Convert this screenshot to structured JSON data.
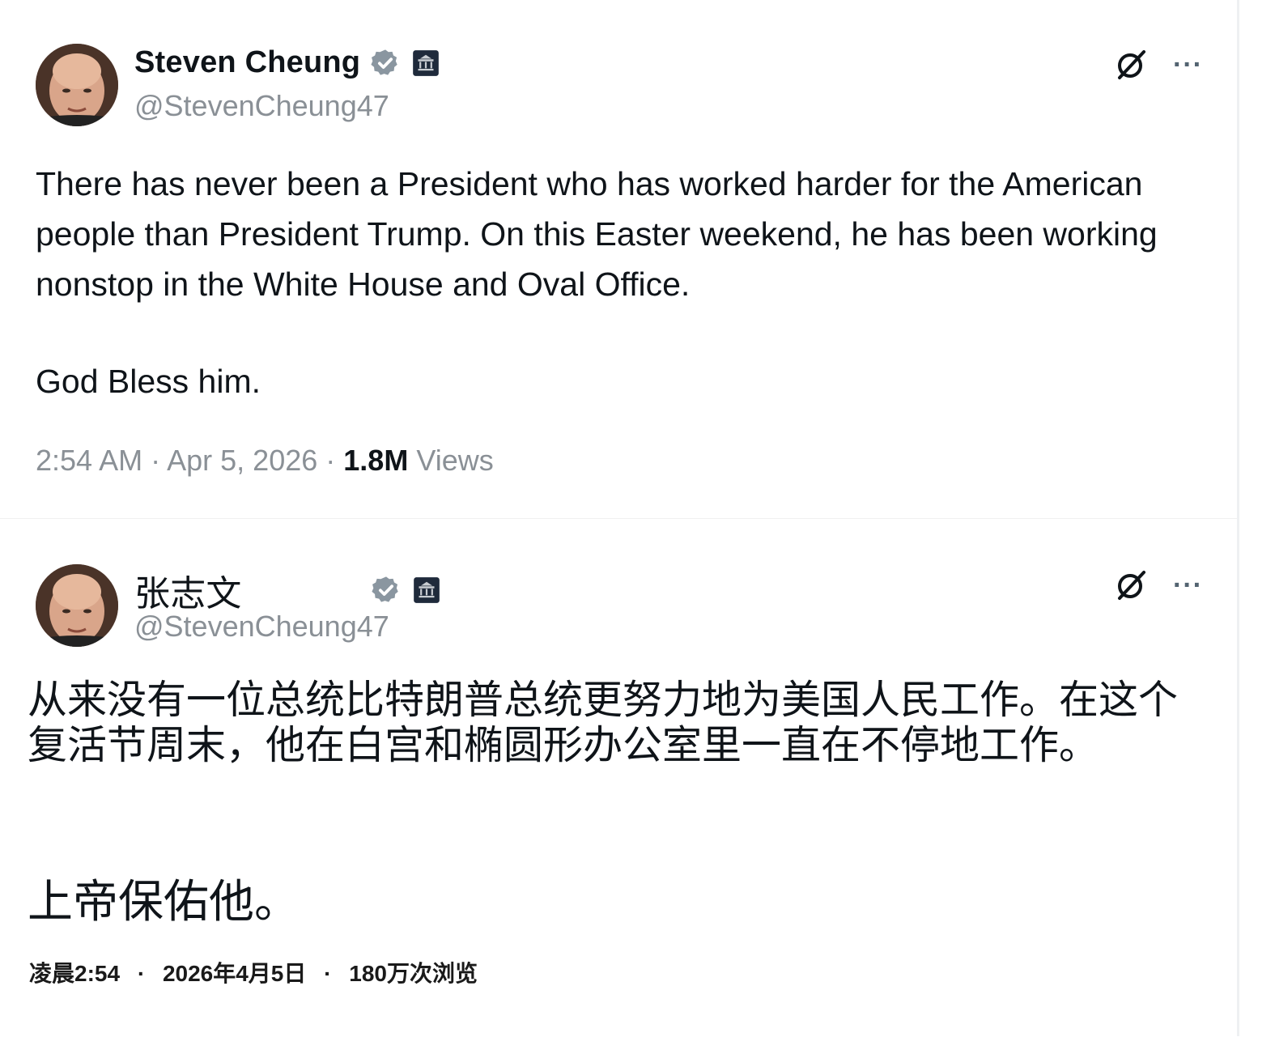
{
  "colors": {
    "text_primary": "#0f1419",
    "text_secondary": "#8a9096",
    "verified_badge": "#8a96a0",
    "gov_badge": "#1f2a3b"
  },
  "tweets": [
    {
      "author": {
        "display_name": "Steven Cheung",
        "handle": "@StevenCheung47",
        "verified_icon": "verified-badge-icon",
        "affiliation_icon": "government-badge-icon"
      },
      "actions": {
        "grok_icon": "grok-icon",
        "more_label": "···"
      },
      "body": {
        "main": "There has never been a President who has worked harder for the American people than President Trump. On this Easter weekend, he has been working nonstop in the White House and Oval Office.",
        "closing": "God Bless him."
      },
      "meta": {
        "time": "2:54 AM",
        "separator": "·",
        "date": "Apr 5, 2026",
        "views_count": "1.8M",
        "views_label": "Views"
      }
    },
    {
      "author": {
        "display_name": "张志文",
        "handle": "@StevenCheung47",
        "verified_icon": "verified-badge-icon",
        "affiliation_icon": "government-badge-icon"
      },
      "actions": {
        "grok_icon": "grok-icon",
        "more_label": "···"
      },
      "body": {
        "main": "从来没有一位总统比特朗普总统更努力地为美国人民工作。在这个复活节周末，他在白宫和椭圆形办公室里一直在不停地工作。",
        "closing": "上帝保佑他。"
      },
      "meta": {
        "time": "凌晨2:54",
        "separator": "·",
        "date": "2026年4月5日",
        "views_count": "180万次浏览",
        "views_label": ""
      }
    }
  ]
}
